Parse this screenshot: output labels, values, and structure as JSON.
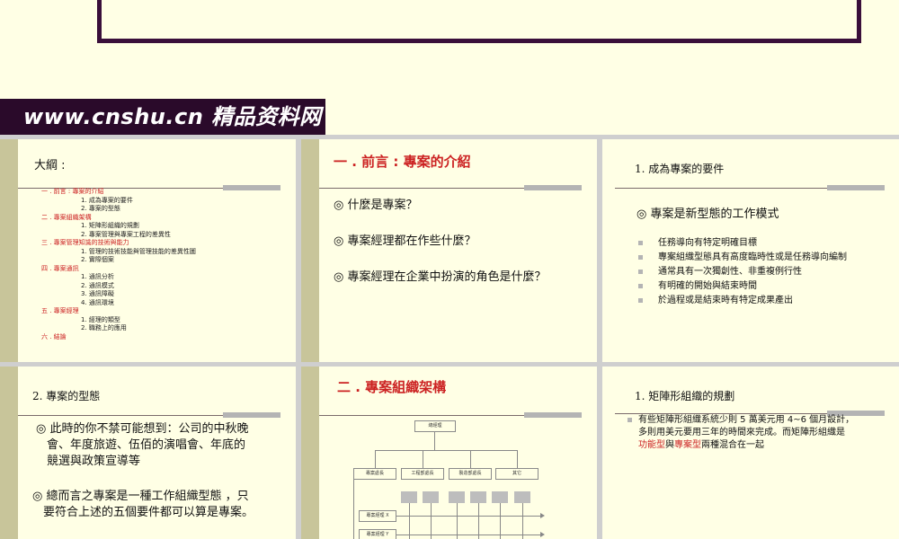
{
  "banner": {
    "text": "www.cnshu.cn  精品资料网"
  },
  "slide1": {
    "title": "大綱 :",
    "outline": [
      {
        "kind": "sec",
        "text": "一 . 前言 : 專案的介紹"
      },
      {
        "kind": "sub",
        "text": "1. 成為專案的要件"
      },
      {
        "kind": "sub",
        "text": "2. 專案的型態"
      },
      {
        "kind": "sec",
        "text": "二 . 專案組織架構"
      },
      {
        "kind": "sub",
        "text": "1. 矩陣形組織的規劃"
      },
      {
        "kind": "sub",
        "text": "2. 專案管理與專案工程的差異性"
      },
      {
        "kind": "sec",
        "text": "三 . 專案管理知識的技術與能力"
      },
      {
        "kind": "sub",
        "text": "1. 管理的技術技能與管理技能的差異性圖"
      },
      {
        "kind": "sub",
        "text": "2. 實際個案"
      },
      {
        "kind": "sec",
        "text": "四 . 專案通訊"
      },
      {
        "kind": "sub",
        "text": "1. 通訊分析"
      },
      {
        "kind": "sub",
        "text": "2. 通訊模式"
      },
      {
        "kind": "sub",
        "text": "3. 通訊障礙"
      },
      {
        "kind": "sub",
        "text": "4. 通訊環境"
      },
      {
        "kind": "sec",
        "text": "五 . 專案經理"
      },
      {
        "kind": "sub",
        "text": "1. 經理的類型"
      },
      {
        "kind": "sub",
        "text": "2. 職務上的應用"
      },
      {
        "kind": "sec",
        "text": "六 . 結論"
      }
    ]
  },
  "slide2": {
    "title": "一 . 前言 : 專案的介紹",
    "q1": "◎ 什麼是專案？",
    "q2": "◎ 專案經理都在作些什麼？",
    "q3": "◎ 專案經理在企業中扮演的角色是什麼？"
  },
  "slide3": {
    "title": "1. 成為專案的要件",
    "lead": "◎ 專案是新型態的工作模式",
    "bullets": [
      "任務導向有特定明確目標",
      "專案組織型態具有高度臨時性或是任務導向編制",
      "通常具有一次獨創性、非重複例行性",
      "有明確的開始與結束時間",
      "於過程或是結束時有特定成果產出"
    ]
  },
  "slide4": {
    "title": "2. 專案的型態",
    "p1_line1": "◎ 此時的你不禁可能想到：公司的中秋晚",
    "p1_line2": "會、年度旅遊、伍佰的演唱會、年底的",
    "p1_line3": "競選與政策宣導等",
    "p2_line1": "◎ 總而言之專案是一種工作組織型態 ，只",
    "p2_line2": "要符合上述的五個要件都可以算是專案。"
  },
  "slide5": {
    "title": "二 . 專案組織架構",
    "chart": {
      "top": "總經理",
      "depts": [
        "專案處長",
        "工程部處長",
        "製造部處長",
        "其它"
      ],
      "rows": [
        "專案經理 X",
        "專案經理 Y"
      ]
    }
  },
  "slide6": {
    "title": "1. 矩陣形組織的規劃",
    "text_a": "有些矩陣形組織系統少則 5 萬美元用  4~6 個月設計，",
    "text_b": "多則用美元要用三年的時間來完成。而矩陣形組織是",
    "red1": "功能型",
    "mid": "與",
    "red2": "專案型",
    "tail": "兩種混合在一起"
  }
}
